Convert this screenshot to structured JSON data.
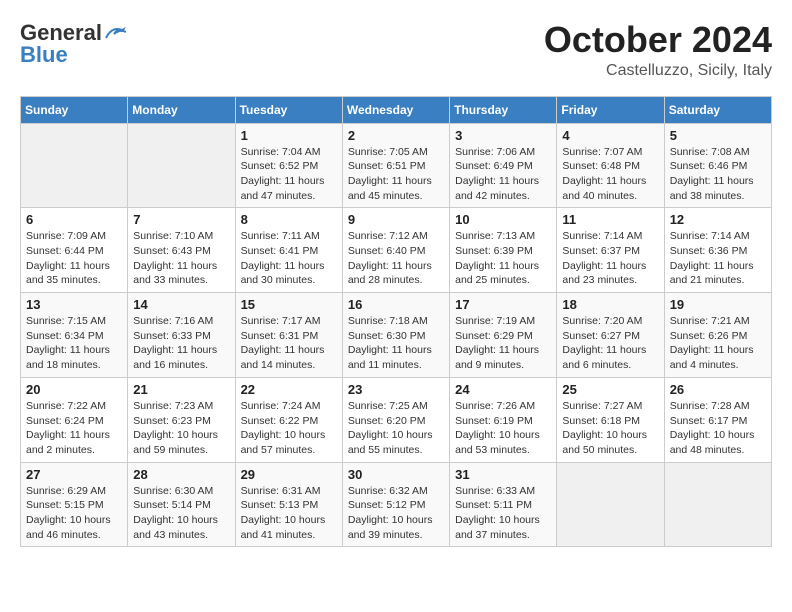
{
  "logo": {
    "general": "General",
    "blue": "Blue"
  },
  "title": {
    "month": "October 2024",
    "location": "Castelluzzo, Sicily, Italy"
  },
  "headers": [
    "Sunday",
    "Monday",
    "Tuesday",
    "Wednesday",
    "Thursday",
    "Friday",
    "Saturday"
  ],
  "weeks": [
    [
      {
        "day": "",
        "info": ""
      },
      {
        "day": "",
        "info": ""
      },
      {
        "day": "1",
        "info": "Sunrise: 7:04 AM\nSunset: 6:52 PM\nDaylight: 11 hours and 47 minutes."
      },
      {
        "day": "2",
        "info": "Sunrise: 7:05 AM\nSunset: 6:51 PM\nDaylight: 11 hours and 45 minutes."
      },
      {
        "day": "3",
        "info": "Sunrise: 7:06 AM\nSunset: 6:49 PM\nDaylight: 11 hours and 42 minutes."
      },
      {
        "day": "4",
        "info": "Sunrise: 7:07 AM\nSunset: 6:48 PM\nDaylight: 11 hours and 40 minutes."
      },
      {
        "day": "5",
        "info": "Sunrise: 7:08 AM\nSunset: 6:46 PM\nDaylight: 11 hours and 38 minutes."
      }
    ],
    [
      {
        "day": "6",
        "info": "Sunrise: 7:09 AM\nSunset: 6:44 PM\nDaylight: 11 hours and 35 minutes."
      },
      {
        "day": "7",
        "info": "Sunrise: 7:10 AM\nSunset: 6:43 PM\nDaylight: 11 hours and 33 minutes."
      },
      {
        "day": "8",
        "info": "Sunrise: 7:11 AM\nSunset: 6:41 PM\nDaylight: 11 hours and 30 minutes."
      },
      {
        "day": "9",
        "info": "Sunrise: 7:12 AM\nSunset: 6:40 PM\nDaylight: 11 hours and 28 minutes."
      },
      {
        "day": "10",
        "info": "Sunrise: 7:13 AM\nSunset: 6:39 PM\nDaylight: 11 hours and 25 minutes."
      },
      {
        "day": "11",
        "info": "Sunrise: 7:14 AM\nSunset: 6:37 PM\nDaylight: 11 hours and 23 minutes."
      },
      {
        "day": "12",
        "info": "Sunrise: 7:14 AM\nSunset: 6:36 PM\nDaylight: 11 hours and 21 minutes."
      }
    ],
    [
      {
        "day": "13",
        "info": "Sunrise: 7:15 AM\nSunset: 6:34 PM\nDaylight: 11 hours and 18 minutes."
      },
      {
        "day": "14",
        "info": "Sunrise: 7:16 AM\nSunset: 6:33 PM\nDaylight: 11 hours and 16 minutes."
      },
      {
        "day": "15",
        "info": "Sunrise: 7:17 AM\nSunset: 6:31 PM\nDaylight: 11 hours and 14 minutes."
      },
      {
        "day": "16",
        "info": "Sunrise: 7:18 AM\nSunset: 6:30 PM\nDaylight: 11 hours and 11 minutes."
      },
      {
        "day": "17",
        "info": "Sunrise: 7:19 AM\nSunset: 6:29 PM\nDaylight: 11 hours and 9 minutes."
      },
      {
        "day": "18",
        "info": "Sunrise: 7:20 AM\nSunset: 6:27 PM\nDaylight: 11 hours and 6 minutes."
      },
      {
        "day": "19",
        "info": "Sunrise: 7:21 AM\nSunset: 6:26 PM\nDaylight: 11 hours and 4 minutes."
      }
    ],
    [
      {
        "day": "20",
        "info": "Sunrise: 7:22 AM\nSunset: 6:24 PM\nDaylight: 11 hours and 2 minutes."
      },
      {
        "day": "21",
        "info": "Sunrise: 7:23 AM\nSunset: 6:23 PM\nDaylight: 10 hours and 59 minutes."
      },
      {
        "day": "22",
        "info": "Sunrise: 7:24 AM\nSunset: 6:22 PM\nDaylight: 10 hours and 57 minutes."
      },
      {
        "day": "23",
        "info": "Sunrise: 7:25 AM\nSunset: 6:20 PM\nDaylight: 10 hours and 55 minutes."
      },
      {
        "day": "24",
        "info": "Sunrise: 7:26 AM\nSunset: 6:19 PM\nDaylight: 10 hours and 53 minutes."
      },
      {
        "day": "25",
        "info": "Sunrise: 7:27 AM\nSunset: 6:18 PM\nDaylight: 10 hours and 50 minutes."
      },
      {
        "day": "26",
        "info": "Sunrise: 7:28 AM\nSunset: 6:17 PM\nDaylight: 10 hours and 48 minutes."
      }
    ],
    [
      {
        "day": "27",
        "info": "Sunrise: 6:29 AM\nSunset: 5:15 PM\nDaylight: 10 hours and 46 minutes."
      },
      {
        "day": "28",
        "info": "Sunrise: 6:30 AM\nSunset: 5:14 PM\nDaylight: 10 hours and 43 minutes."
      },
      {
        "day": "29",
        "info": "Sunrise: 6:31 AM\nSunset: 5:13 PM\nDaylight: 10 hours and 41 minutes."
      },
      {
        "day": "30",
        "info": "Sunrise: 6:32 AM\nSunset: 5:12 PM\nDaylight: 10 hours and 39 minutes."
      },
      {
        "day": "31",
        "info": "Sunrise: 6:33 AM\nSunset: 5:11 PM\nDaylight: 10 hours and 37 minutes."
      },
      {
        "day": "",
        "info": ""
      },
      {
        "day": "",
        "info": ""
      }
    ]
  ]
}
